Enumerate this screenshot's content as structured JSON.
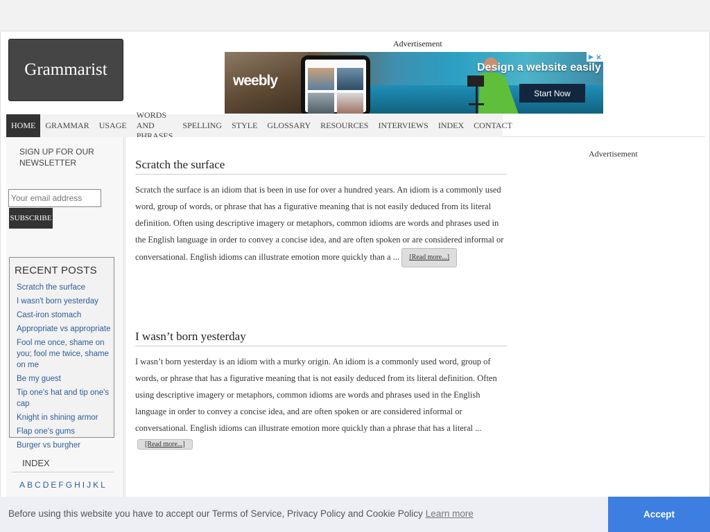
{
  "logo": {
    "text": "Grammarist"
  },
  "header_ad": {
    "label": "Advertisement",
    "brand": "weebly",
    "headline": "Design a website easily",
    "cta": "Start Now"
  },
  "nav": {
    "items": [
      {
        "label": "HOME",
        "active": true
      },
      {
        "label": "GRAMMAR"
      },
      {
        "label": "USAGE"
      },
      {
        "label": "WORDS AND PHRASES"
      },
      {
        "label": "SPELLING"
      },
      {
        "label": "STYLE"
      },
      {
        "label": "GLOSSARY"
      },
      {
        "label": "RESOURCES"
      },
      {
        "label": "INTERVIEWS"
      },
      {
        "label": "INDEX"
      },
      {
        "label": "CONTACT"
      }
    ]
  },
  "sidebar": {
    "signup_label": "SIGN UP FOR OUR NEWSLETTER",
    "email_placeholder": "Your email address",
    "subscribe_label": "SUBSCRIBE",
    "recent_title": "RECENT POSTS",
    "recent_posts": [
      "Scratch the surface",
      "I wasn't born yesterday",
      "Cast-iron stomach",
      "Appropriate vs appropriate",
      "Fool me once, shame on you; fool me twice, shame on me",
      "Be my guest",
      "Tip one's hat and tip one's cap",
      "Knight in shining armor",
      "Flap one's gums",
      "Burger vs burgher"
    ],
    "index_title": "INDEX",
    "index_letters": [
      "A",
      "B",
      "C",
      "D",
      "E",
      "F",
      "G",
      "H",
      "I",
      "J",
      "K",
      "L"
    ]
  },
  "main": {
    "right_ad_label": "Advertisement",
    "posts": [
      {
        "title": "Scratch the surface",
        "excerpt": "Scratch the surface is an idiom that is been in use for over a hundred years. An idiom is a commonly used word, group of words, or phrase that has a figurative meaning that is not easily deduced from its literal definition. Often using descriptive imagery or metaphors, common idioms are words and phrases used in the English language in order to convey a concise idea, and are often spoken or are considered informal or conversational. English idioms can illustrate emotion more quickly than a ...",
        "read_more": "[Read more...]"
      },
      {
        "title": "I wasn’t born yesterday",
        "excerpt": "I wasn’t born yesterday is an idiom with a murky origin. An idiom is a commonly used word, group of words, or phrase that has a figurative meaning that is not easily deduced from its literal definition. Often using descriptive imagery or metaphors, common idioms are words and phrases used in the English language in order to convey a concise idea, and are often spoken or are considered informal or conversational. English idioms can illustrate emotion more quickly than a phrase that has a literal ...",
        "read_more": "[Read more...]"
      }
    ],
    "close_label": "X"
  },
  "cookie": {
    "message": "Before using this website you have to accept our Terms of Service, Privacy Policy and Cookie Policy",
    "learn_more": "Learn more",
    "accept": "Accept"
  },
  "colors": {
    "logo_bg": "#454545",
    "nav_active_bg": "#333333",
    "link": "#2e5c9a",
    "accept_bg": "#3d7fe0",
    "cookie_bg": "#edeff5"
  }
}
